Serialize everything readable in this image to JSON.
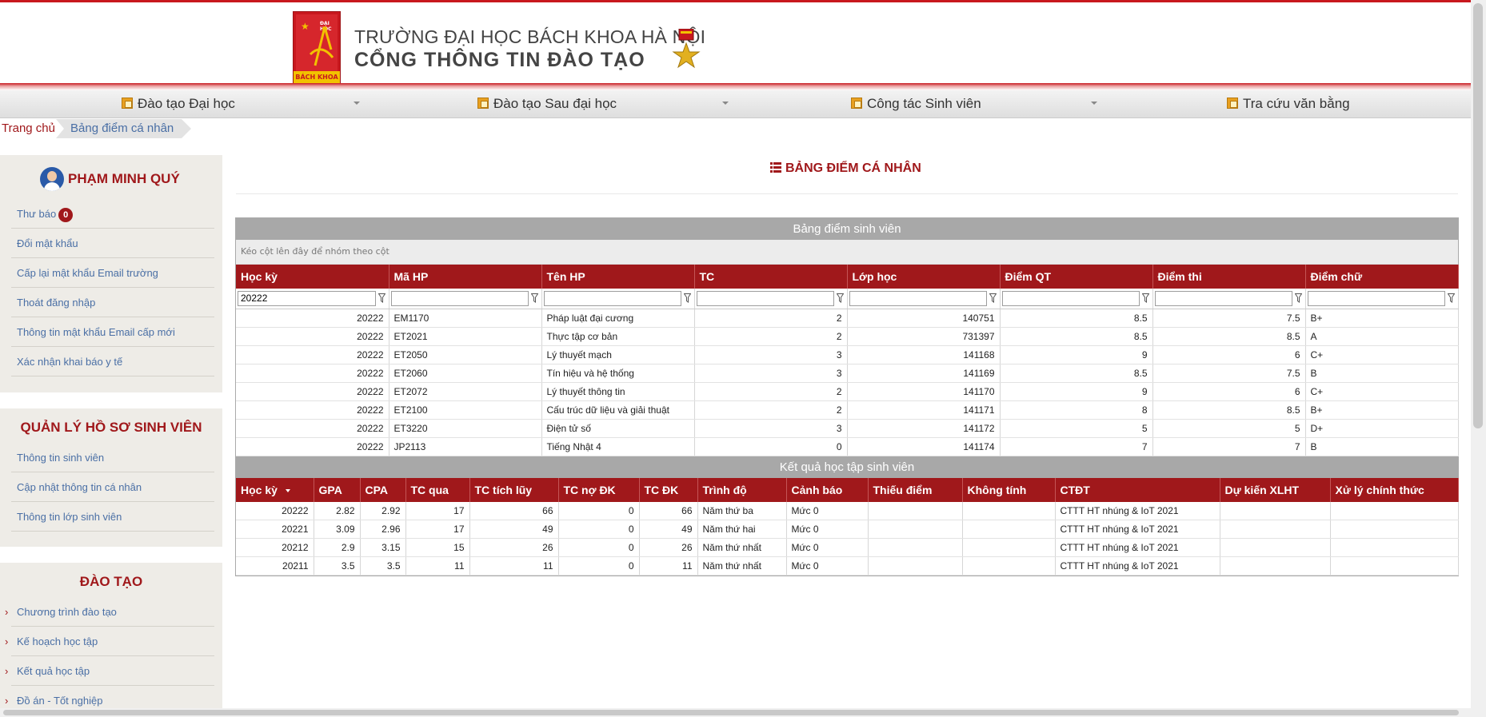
{
  "header": {
    "logo_caption": "BÁCH KHOA",
    "logo_small_text": "ĐẠI HỌC",
    "school_name": "TRƯỜNG ĐẠI HỌC BÁCH KHOA HÀ NỘI",
    "portal_name": "CỔNG THÔNG TIN ĐÀO TẠO"
  },
  "nav": {
    "items": [
      {
        "label": "Đào tạo Đại học",
        "has_dropdown": true
      },
      {
        "label": "Đào tạo Sau đại học",
        "has_dropdown": true
      },
      {
        "label": "Công tác Sinh viên",
        "has_dropdown": true
      },
      {
        "label": "Tra cứu văn bằng",
        "has_dropdown": false
      }
    ]
  },
  "breadcrumb": {
    "home": "Trang chủ",
    "current": "Bảng điểm cá nhân"
  },
  "sidebar": {
    "user_name": "PHẠM MINH QUÝ",
    "account_links": [
      {
        "label": "Thư báo",
        "badge": "0"
      },
      {
        "label": "Đổi mật khẩu"
      },
      {
        "label": "Cấp lại mật khẩu Email trường"
      },
      {
        "label": "Thoát đăng nhập"
      },
      {
        "label": "Thông tin mật khẩu Email cấp mới"
      },
      {
        "label": "Xác nhận khai báo y tế"
      }
    ],
    "profile_title": "QUẢN LÝ HỒ SƠ SINH VIÊN",
    "profile_links": [
      {
        "label": "Thông tin sinh viên"
      },
      {
        "label": "Cập nhật thông tin cá nhân"
      },
      {
        "label": "Thông tin lớp sinh viên"
      }
    ],
    "training_title": "ĐÀO TẠO",
    "training_links": [
      {
        "label": "Chương trình đào tạo"
      },
      {
        "label": "Kế hoạch học tập"
      },
      {
        "label": "Kết quả học tập"
      },
      {
        "label": "Đồ án - Tốt nghiệp"
      }
    ]
  },
  "main": {
    "title": "BẢNG ĐIỂM CÁ NHÂN",
    "grades": {
      "caption": "Bảng điểm sinh viên",
      "group_hint": "Kéo cột lên đây để nhóm theo cột",
      "columns": [
        "Học kỳ",
        "Mã HP",
        "Tên HP",
        "TC",
        "Lớp học",
        "Điểm QT",
        "Điểm thi",
        "Điểm chữ"
      ],
      "filter_values": [
        "20222",
        "",
        "",
        "",
        "",
        "",
        "",
        ""
      ],
      "rows": [
        [
          "20222",
          "EM1170",
          "Pháp luật đại cương",
          "2",
          "140751",
          "8.5",
          "7.5",
          "B+"
        ],
        [
          "20222",
          "ET2021",
          "Thực tập cơ bản",
          "2",
          "731397",
          "8.5",
          "8.5",
          "A"
        ],
        [
          "20222",
          "ET2050",
          "Lý thuyết mạch",
          "3",
          "141168",
          "9",
          "6",
          "C+"
        ],
        [
          "20222",
          "ET2060",
          "Tín hiệu và hệ thống",
          "3",
          "141169",
          "8.5",
          "7.5",
          "B"
        ],
        [
          "20222",
          "ET2072",
          "Lý thuyết thông tin",
          "2",
          "141170",
          "9",
          "6",
          "C+"
        ],
        [
          "20222",
          "ET2100",
          "Cấu trúc dữ liệu và giải thuật",
          "2",
          "141171",
          "8",
          "8.5",
          "B+"
        ],
        [
          "20222",
          "ET3220",
          "Điện tử số",
          "3",
          "141172",
          "5",
          "5",
          "D+"
        ],
        [
          "20222",
          "JP2113",
          "Tiếng Nhật 4",
          "0",
          "141174",
          "7",
          "7",
          "B"
        ]
      ]
    },
    "results": {
      "caption": "Kết quả học tập sinh viên",
      "columns": [
        "Học kỳ",
        "GPA",
        "CPA",
        "TC qua",
        "TC tích lũy",
        "TC nợ ĐK",
        "TC ĐK",
        "Trình độ",
        "Cảnh báo",
        "Thiếu điểm",
        "Không tính",
        "CTĐT",
        "Dự kiến XLHT",
        "Xử lý chính thức"
      ],
      "rows": [
        [
          "20222",
          "2.82",
          "2.92",
          "17",
          "66",
          "0",
          "66",
          "Năm thứ ba",
          "Mức 0",
          "",
          "",
          "CTTT HT nhúng & IoT 2021",
          "",
          ""
        ],
        [
          "20221",
          "3.09",
          "2.96",
          "17",
          "49",
          "0",
          "49",
          "Năm thứ hai",
          "Mức 0",
          "",
          "",
          "CTTT HT nhúng & IoT 2021",
          "",
          ""
        ],
        [
          "20212",
          "2.9",
          "3.15",
          "15",
          "26",
          "0",
          "26",
          "Năm thứ nhất",
          "Mức 0",
          "",
          "",
          "CTTT HT nhúng & IoT 2021",
          "",
          ""
        ],
        [
          "20211",
          "3.5",
          "3.5",
          "11",
          "11",
          "0",
          "11",
          "Năm thứ nhất",
          "Mức 0",
          "",
          "",
          "CTTT HT nhúng & IoT 2021",
          "",
          ""
        ]
      ]
    }
  },
  "colors": {
    "brand_red": "#a0181b",
    "header_red": "#c8181e",
    "link_blue": "#4a6fa5",
    "sidebar_bg": "#eeece7",
    "caption_gray": "#a8a8a8"
  },
  "icons": [
    "logo-emblem",
    "medal-icon",
    "menu-icon",
    "dropdown-caret-icon",
    "avatar",
    "list-icon",
    "filter-icon",
    "sort-caret-icon",
    "chevron-right-icon"
  ]
}
